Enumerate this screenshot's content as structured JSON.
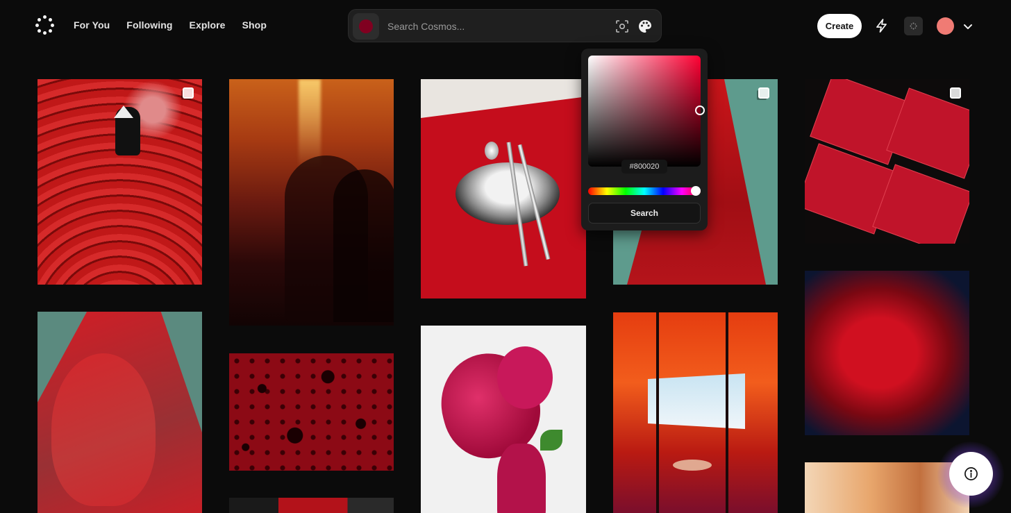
{
  "nav": {
    "items": [
      "For You",
      "Following",
      "Explore",
      "Shop"
    ]
  },
  "search": {
    "placeholder": "Search Cosmos...",
    "selected_color": "#800020",
    "icons": [
      "image-scan-icon",
      "palette-icon"
    ]
  },
  "header": {
    "create_label": "Create",
    "icons": [
      "bolt-icon",
      "chevron-down-icon"
    ],
    "avatar_color": "#f07b74"
  },
  "picker": {
    "hex_value": "#800020",
    "search_label": "Search"
  },
  "colors": {
    "background": "#0b0b0b",
    "accent": "#800020"
  }
}
